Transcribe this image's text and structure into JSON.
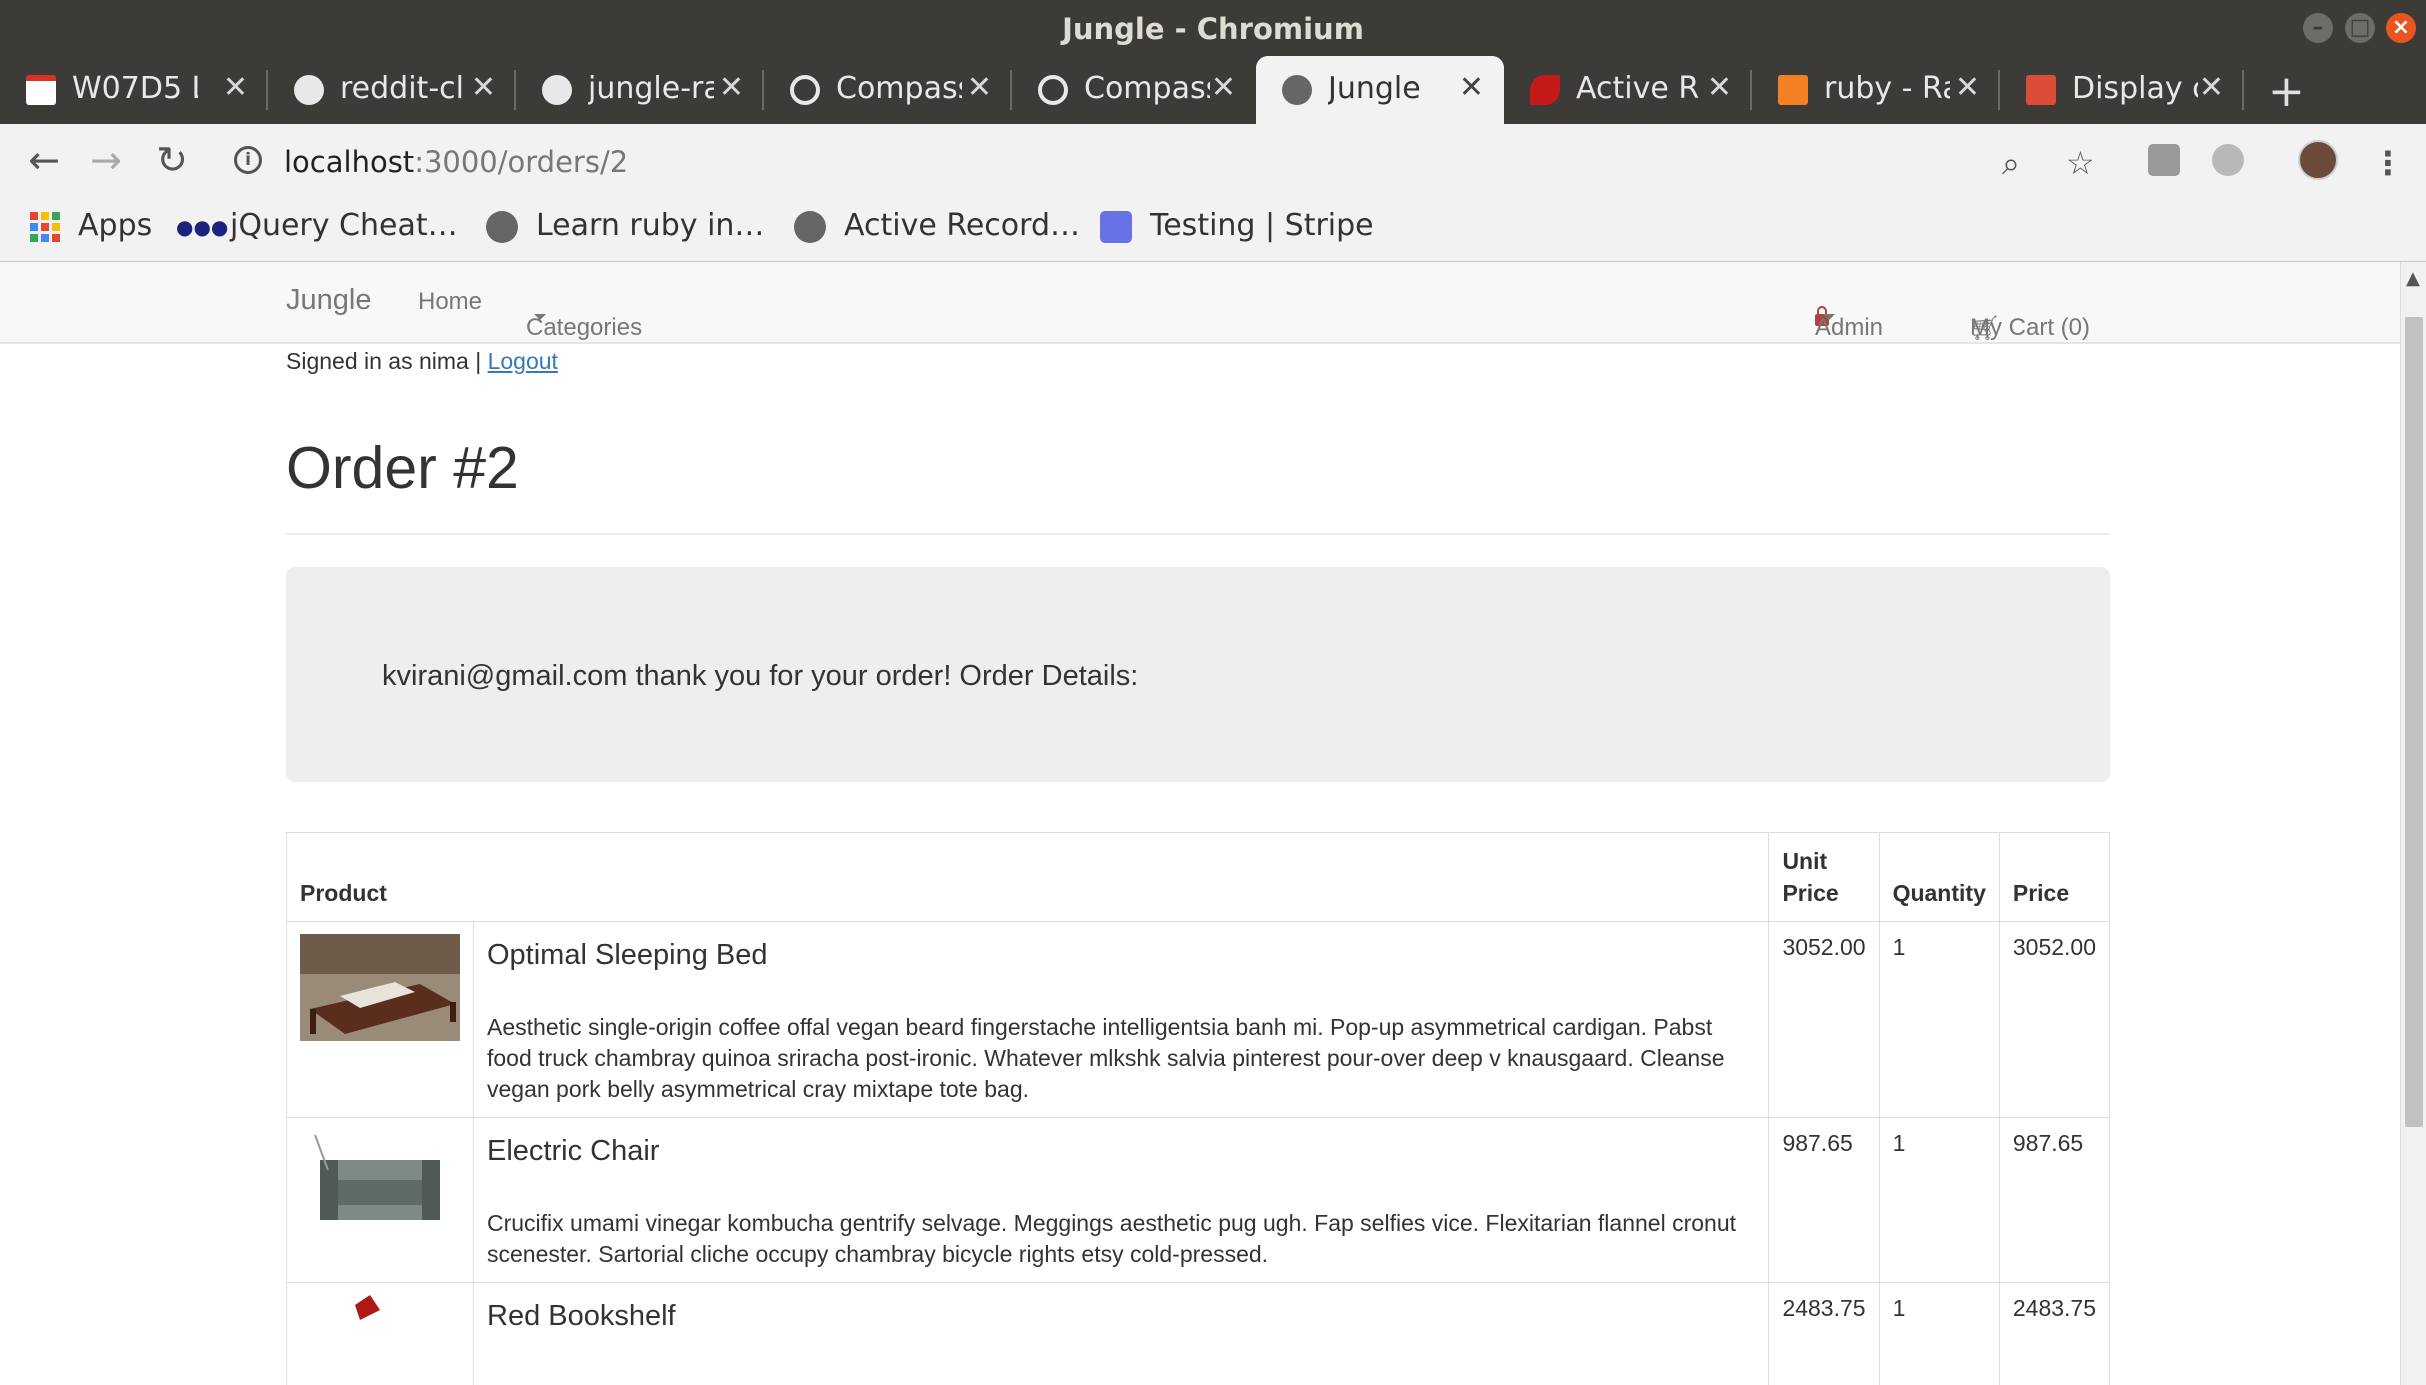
{
  "window": {
    "title": "Jungle - Chromium"
  },
  "tabs": [
    {
      "label": "W07D5 L",
      "icon": "gmail-icon",
      "active": false
    },
    {
      "label": "reddit-cl",
      "icon": "github-icon",
      "active": false
    },
    {
      "label": "jungle-ra",
      "icon": "github-icon",
      "active": false
    },
    {
      "label": "Compass",
      "icon": "compass-icon",
      "active": false
    },
    {
      "label": "Compass",
      "icon": "compass-icon",
      "active": false
    },
    {
      "label": "Jungle",
      "icon": "globe-icon",
      "active": true
    },
    {
      "label": "Active R",
      "icon": "rails-icon",
      "active": false
    },
    {
      "label": "ruby - Ra",
      "icon": "stackoverflow-icon",
      "active": false
    },
    {
      "label": "Display c",
      "icon": "red-square-icon",
      "active": false
    }
  ],
  "address_bar": {
    "host": "localhost",
    "path": ":3000/orders/2"
  },
  "bookmarks": [
    {
      "label": "Apps",
      "icon": "apps-grid-icon"
    },
    {
      "label": "jQuery Cheat…",
      "icon": "dots-icon"
    },
    {
      "label": "Learn ruby in…",
      "icon": "globe-icon"
    },
    {
      "label": "Active Record…",
      "icon": "globe-icon"
    },
    {
      "label": "Testing | Stripe",
      "icon": "stripe-icon"
    }
  ],
  "navbar": {
    "brand": "Jungle",
    "home": "Home",
    "categories": "Categories",
    "admin": "Admin",
    "cart": "My Cart (0)"
  },
  "session": {
    "signed_in_text": "Signed in as nima |",
    "logout": "Logout"
  },
  "order": {
    "title": "Order #2",
    "message": "kvirani@gmail.com thank you for your order! Order Details:"
  },
  "table": {
    "headers": {
      "product": "Product",
      "unit_price": "Unit Price",
      "quantity": "Quantity",
      "price": "Price"
    },
    "rows": [
      {
        "name": "Optimal Sleeping Bed",
        "description": "Aesthetic single-origin coffee offal vegan beard fingerstache intelligentsia banh mi. Pop-up asymmetrical cardigan. Pabst food truck chambray quinoa sriracha post-ironic. Whatever mlkshk salvia pinterest pour-over deep v knausgaard. Cleanse vegan pork belly asymmetrical cray mixtape tote bag.",
        "unit_price": "3052.00",
        "quantity": "1",
        "price": "3052.00"
      },
      {
        "name": "Electric Chair",
        "description": "Crucifix umami vinegar kombucha gentrify selvage. Meggings aesthetic pug ugh. Fap selfies vice. Flexitarian flannel cronut scenester. Sartorial cliche occupy chambray bicycle rights etsy cold-pressed.",
        "unit_price": "987.65",
        "quantity": "1",
        "price": "987.65"
      },
      {
        "name": "Red Bookshelf",
        "description": "",
        "unit_price": "2483.75",
        "quantity": "1",
        "price": "2483.75"
      }
    ]
  },
  "colors": {
    "link": "#337ab7",
    "admin": "#a94442",
    "jumbotron": "#eeeeee",
    "titlebar": "#3c3b37"
  }
}
